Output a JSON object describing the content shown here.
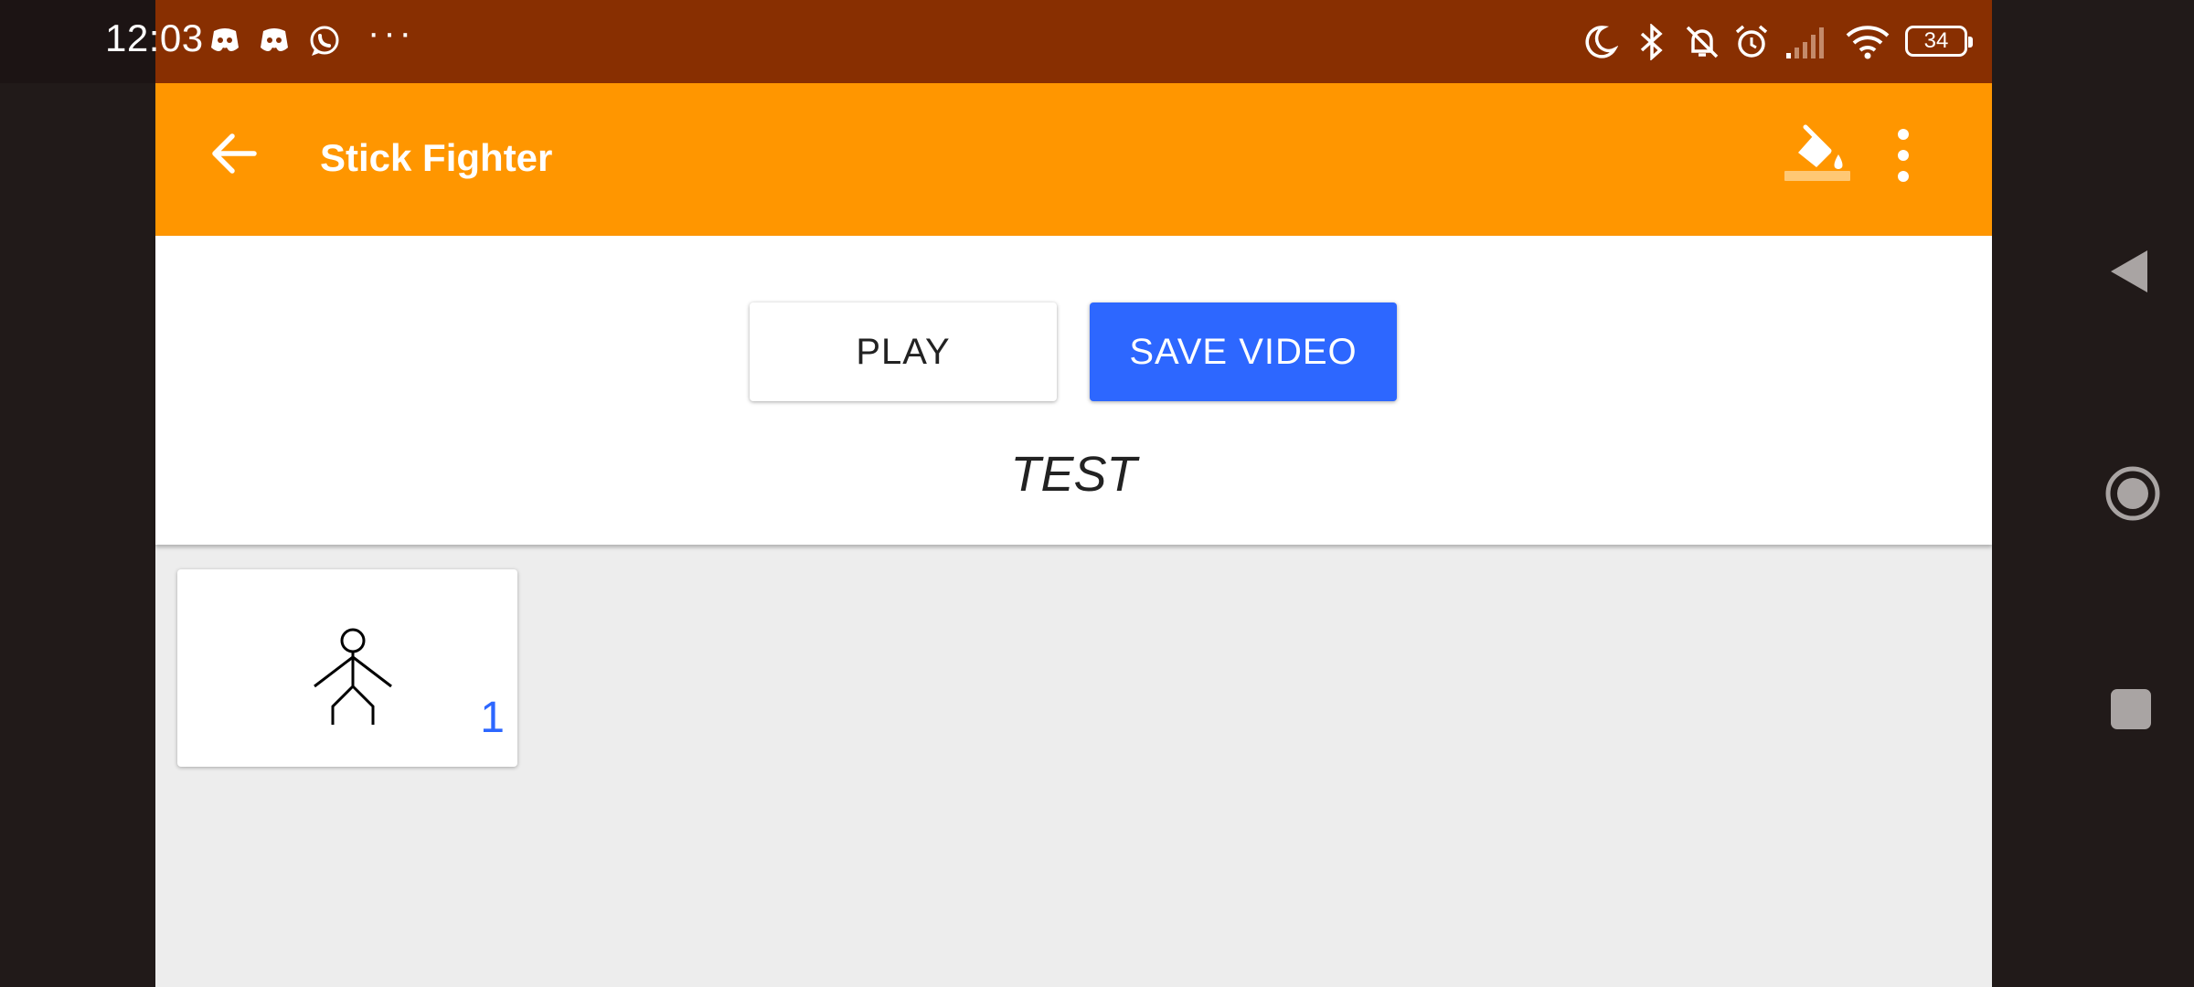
{
  "status_bar": {
    "time": "12:03",
    "more_indicator": "···",
    "battery": "34",
    "left_icons": [
      "discord-icon",
      "discord-icon",
      "whatsapp-icon"
    ],
    "right_icons": [
      "moon-icon",
      "bluetooth-icon",
      "bell-off-icon",
      "alarm-icon",
      "signal-icon",
      "wifi-icon",
      "battery-icon"
    ]
  },
  "app_bar": {
    "title": "Stick Fighter",
    "back_icon": "arrow-left-icon",
    "paint_icon": "format-color-fill-icon",
    "menu_icon": "more-vertical-icon",
    "color": "#ff9600"
  },
  "controls": {
    "play_label": "PLAY",
    "save_label": "SAVE VIDEO",
    "animation_title": "TEST",
    "accent": "#2d67ff"
  },
  "frames": [
    {
      "number": "1",
      "preview": "stick-figure"
    }
  ],
  "nav_bar": {
    "icons": [
      "back-triangle-icon",
      "home-circle-icon",
      "recents-square-icon"
    ]
  }
}
